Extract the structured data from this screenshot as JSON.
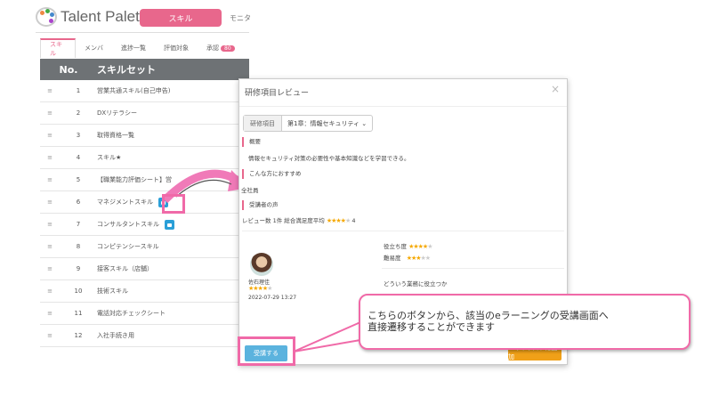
{
  "header": {
    "logo_text": "Talent Palette",
    "nav_active": "スキル",
    "nav_next": "モニタ"
  },
  "tabs": [
    {
      "label": "スキル"
    },
    {
      "label": "メンバ"
    },
    {
      "label": "進捗一覧"
    },
    {
      "label": "評価対象"
    },
    {
      "label": "承認",
      "badge": "80"
    }
  ],
  "table": {
    "headers": [
      "No.",
      "スキルセット"
    ],
    "rows": [
      {
        "no": "1",
        "name": "営業共通スキル(自己申告)"
      },
      {
        "no": "2",
        "name": "DXリテラシー"
      },
      {
        "no": "3",
        "name": "取得資格一覧"
      },
      {
        "no": "4",
        "name": "スキル★"
      },
      {
        "no": "5",
        "name": "【職業能力評価シート】営"
      },
      {
        "no": "6",
        "name": "マネジメントスキル"
      },
      {
        "no": "7",
        "name": "コンサルタントスキル"
      },
      {
        "no": "8",
        "name": "コンピテンシースキル"
      },
      {
        "no": "9",
        "name": "接客スキル（店舗）"
      },
      {
        "no": "10",
        "name": "技術スキル"
      },
      {
        "no": "11",
        "name": "電話対応チェックシート"
      },
      {
        "no": "12",
        "name": "入社手続き用"
      }
    ]
  },
  "modal": {
    "title": "研修項目レビュー",
    "close": "×",
    "select_label": "研修項目",
    "select_value": "第1章：情報セキュリティ",
    "overview_heading": "概要",
    "overview_text": "情報セキュリティ対策の必要性や基本知識などを学習できる。",
    "recommend_heading": "こんな方におすすめ",
    "recommend_text": "全社員",
    "voice_heading": "受講者の声",
    "review_summary": "レビュー数 1件  総合満足度平均",
    "review_avg": "4",
    "reviewer_name": "佐石理佳",
    "reviewer_rating": 4,
    "review_date": "2022-07-29 13:27",
    "usefulness_label": "役立ち度",
    "usefulness": 4,
    "difficulty_label": "難易度",
    "difficulty": 3,
    "question": "どういう業務に役立つか",
    "take_button": "受講する",
    "mylist_button": "★マイリストに追加"
  },
  "callout": {
    "line1": "こちらのボタンから、該当のeラーニングの受講画面へ",
    "line2": "直接遷移することができます"
  },
  "colors": {
    "accent": "#e8678c",
    "header": "#6e7275",
    "button": "#5bb3de",
    "highlight": "#f06aa8"
  }
}
